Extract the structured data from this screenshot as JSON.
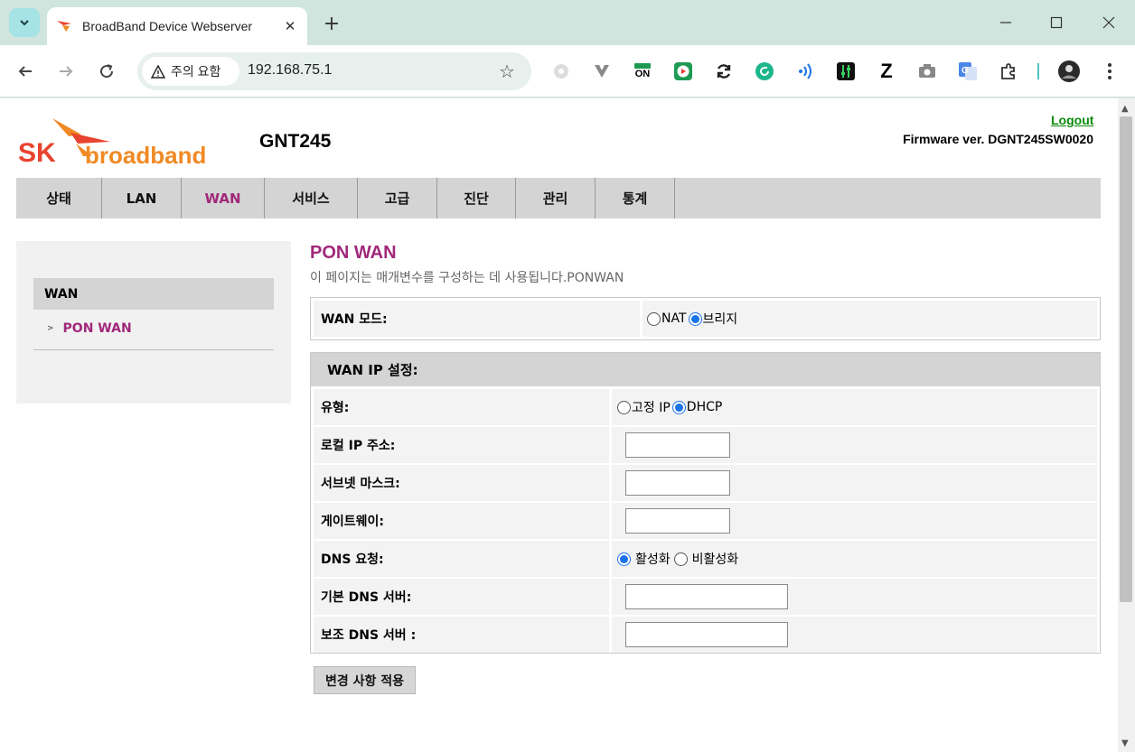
{
  "browser": {
    "tab_title": "BroadBand Device Webserver",
    "security_label": "주의 요함",
    "url": "192.168.75.1",
    "extensions": [
      "ON",
      "Z"
    ]
  },
  "header": {
    "logo_sk": "SK",
    "logo_text": "broadband",
    "model": "GNT245",
    "logout": "Logout",
    "firmware": "Firmware ver. DGNT245SW0020"
  },
  "menu": [
    {
      "label": "상태",
      "active": false
    },
    {
      "label": "LAN",
      "active": false
    },
    {
      "label": "WAN",
      "active": true
    },
    {
      "label": "서비스",
      "active": false
    },
    {
      "label": "고급",
      "active": false
    },
    {
      "label": "진단",
      "active": false
    },
    {
      "label": "관리",
      "active": false
    },
    {
      "label": "통계",
      "active": false
    }
  ],
  "sidebar": {
    "section": "WAN",
    "items": [
      {
        "label": "PON WAN"
      }
    ]
  },
  "main": {
    "title": "PON WAN",
    "description": "이 페이지는 매개변수를 구성하는 데 사용됩니다.PONWAN",
    "wan_mode": {
      "label": "WAN 모드:",
      "options": [
        "NAT",
        "브리지"
      ],
      "selected": "브리지"
    },
    "ip_section": {
      "title": "WAN IP 설정:",
      "type_label": "유형:",
      "type_options": [
        "고정 IP",
        "DHCP"
      ],
      "type_selected": "DHCP",
      "local_ip_label": "로컬 IP 주소:",
      "local_ip_value": "",
      "subnet_label": "서브넷 마스크:",
      "subnet_value": "",
      "gateway_label": "게이트웨이:",
      "gateway_value": "",
      "dns_request_label": "DNS 요청:",
      "dns_options": [
        "활성화",
        "비활성화"
      ],
      "dns_selected": "활성화",
      "primary_dns_label": "기본 DNS 서버:",
      "primary_dns_value": "",
      "secondary_dns_label": "보조 DNS 서버 :",
      "secondary_dns_value": ""
    },
    "apply_button": "변경 사항 적용"
  },
  "colors": {
    "accent": "#a0287a",
    "logo_red": "#e8432e",
    "logo_orange": "#f08a24",
    "logout_green": "#0a8a0a",
    "menu_bg": "#d4d4d4",
    "radio_blue": "#1a73e8"
  }
}
